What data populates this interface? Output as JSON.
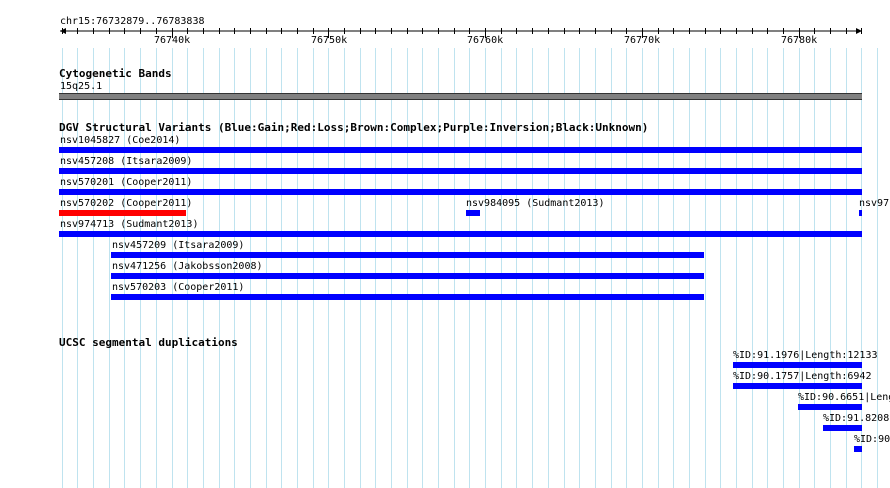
{
  "ruler": {
    "location": "chr15:76732879..76783838",
    "ticks": [
      "76740k",
      "76750k",
      "76760k",
      "76770k",
      "76780k"
    ]
  },
  "cytobands": {
    "title": "Cytogenetic Bands",
    "band_label": "15q25.1",
    "band_color": "#808080"
  },
  "dgv": {
    "title": "DGV Structural Variants (Blue:Gain;Red:Loss;Brown:Complex;Purple:Inversion;Black:Unknown)",
    "colors": {
      "gain": "#0000ff",
      "loss": "#ff0000"
    },
    "features": [
      {
        "label": "nsv1045827 (Coe2014)",
        "type": "gain"
      },
      {
        "label": "nsv457208 (Itsara2009)",
        "type": "gain"
      },
      {
        "label": "nsv570201 (Cooper2011)",
        "type": "gain"
      },
      {
        "label": "nsv570202 (Cooper2011)",
        "type": "loss"
      },
      {
        "label": "nsv984095 (Sudmant2013)",
        "type": "gain"
      },
      {
        "label": "nsv97",
        "type": "gain"
      },
      {
        "label": "nsv974713 (Sudmant2013)",
        "type": "gain"
      },
      {
        "label": "nsv457209 (Itsara2009)",
        "type": "gain"
      },
      {
        "label": "nsv471256 (Jakobsson2008)",
        "type": "gain"
      },
      {
        "label": "nsv570203 (Cooper2011)",
        "type": "gain"
      }
    ]
  },
  "segdups": {
    "title": "UCSC segmental duplications",
    "color": "#0000ff",
    "features": [
      {
        "label": "%ID:91.1976|Length:12133"
      },
      {
        "label": "%ID:90.1757|Length:6942"
      },
      {
        "label": "%ID:90.6651|Leng"
      },
      {
        "label": "%ID:91.8208"
      },
      {
        "label": "%ID:90"
      }
    ]
  }
}
